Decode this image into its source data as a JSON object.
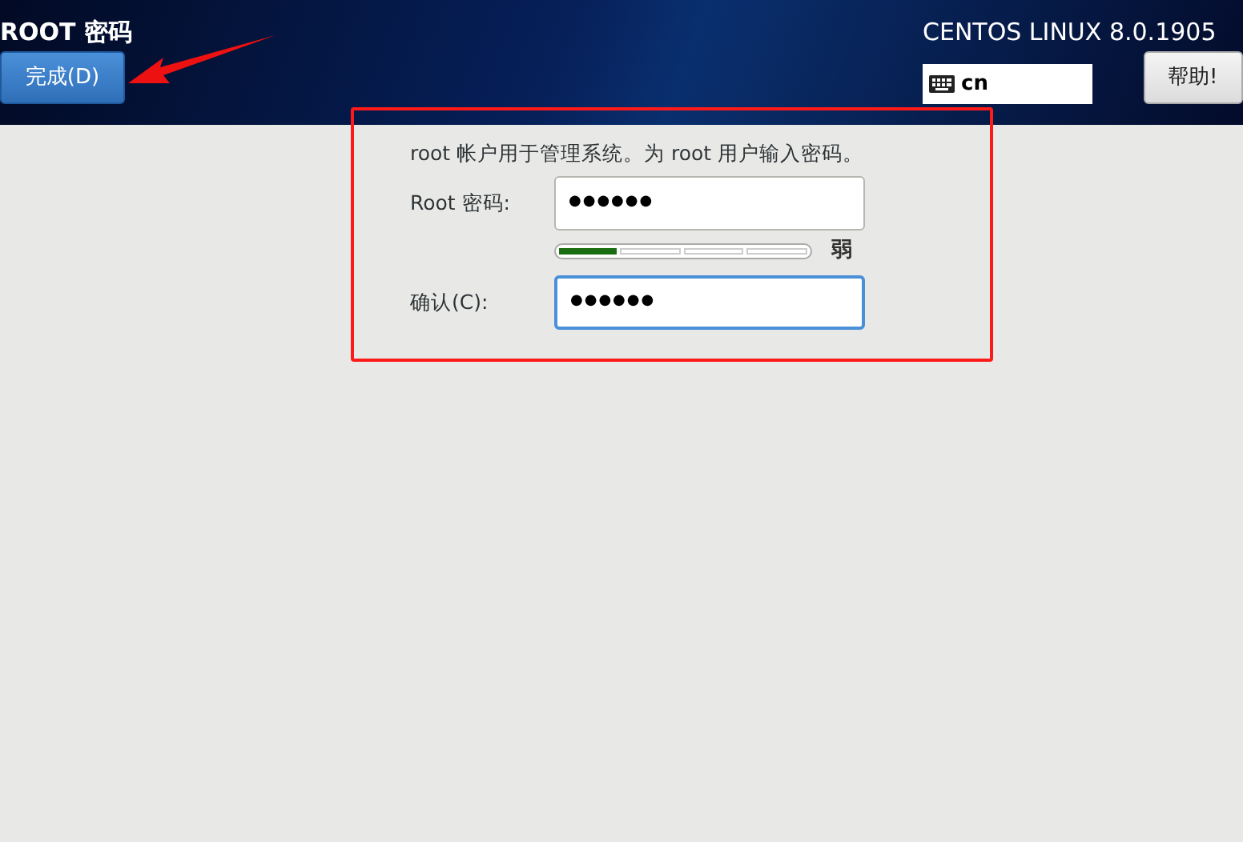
{
  "header": {
    "title": "ROOT 密码",
    "done_button": "完成(D)",
    "product": "CENTOS LINUX 8.0.1905",
    "keyboard_layout": "cn",
    "help_button": "帮助!"
  },
  "form": {
    "description": "root 帐户用于管理系统。为 root 用户输入密码。",
    "fields": [
      {
        "label": "Root 密码:",
        "value": "●●●●●●",
        "focused": false
      },
      {
        "kind": "meter",
        "level": 0.25,
        "reading": "弱"
      },
      {
        "label": "确认(C):",
        "value": "●●●●●●",
        "focused": true
      }
    ]
  }
}
